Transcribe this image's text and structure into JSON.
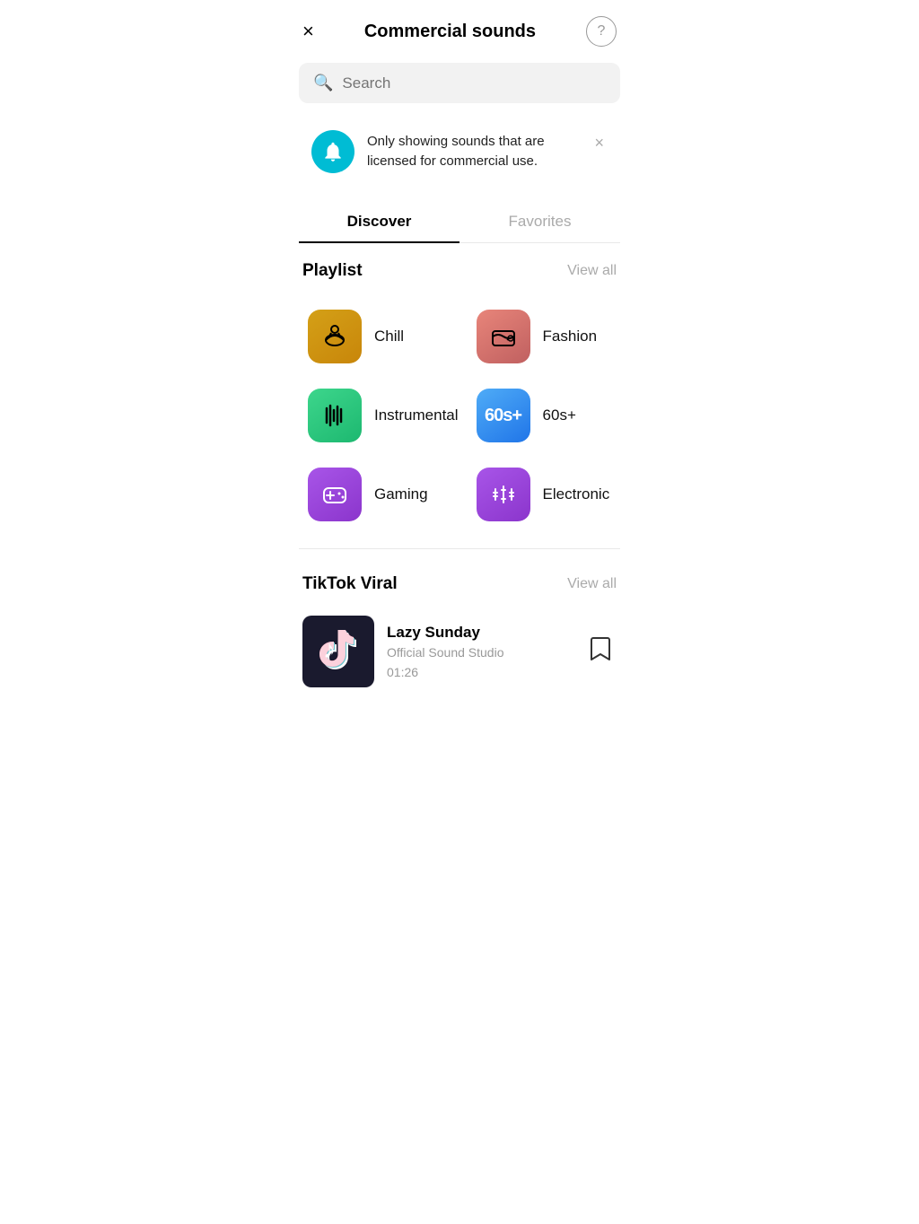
{
  "header": {
    "title": "Commercial sounds",
    "close_label": "×",
    "help_label": "?"
  },
  "search": {
    "placeholder": "Search"
  },
  "notice": {
    "text": "Only showing sounds that are licensed for commercial use."
  },
  "tabs": [
    {
      "id": "discover",
      "label": "Discover",
      "active": true
    },
    {
      "id": "favorites",
      "label": "Favorites",
      "active": false
    }
  ],
  "playlist_section": {
    "title": "Playlist",
    "view_all_label": "View all",
    "items": [
      {
        "id": "chill",
        "name": "Chill",
        "icon_class": "icon-chill",
        "icon_type": "chill"
      },
      {
        "id": "fashion",
        "name": "Fashion",
        "icon_class": "icon-fashion",
        "icon_type": "fashion"
      },
      {
        "id": "instrumental",
        "name": "Instrumental",
        "icon_class": "icon-instrumental",
        "icon_type": "instrumental"
      },
      {
        "id": "60s",
        "name": "60s+",
        "icon_class": "icon-60s",
        "icon_type": "60s"
      },
      {
        "id": "gaming",
        "name": "Gaming",
        "icon_class": "icon-gaming",
        "icon_type": "gaming"
      },
      {
        "id": "electronic",
        "name": "Electronic",
        "icon_class": "icon-electronic",
        "icon_type": "electronic"
      }
    ]
  },
  "viral_section": {
    "title": "TikTok Viral",
    "view_all_label": "View all",
    "songs": [
      {
        "id": "lazy-sunday",
        "title": "Lazy Sunday",
        "artist": "Official Sound Studio",
        "duration": "01:26"
      }
    ]
  }
}
